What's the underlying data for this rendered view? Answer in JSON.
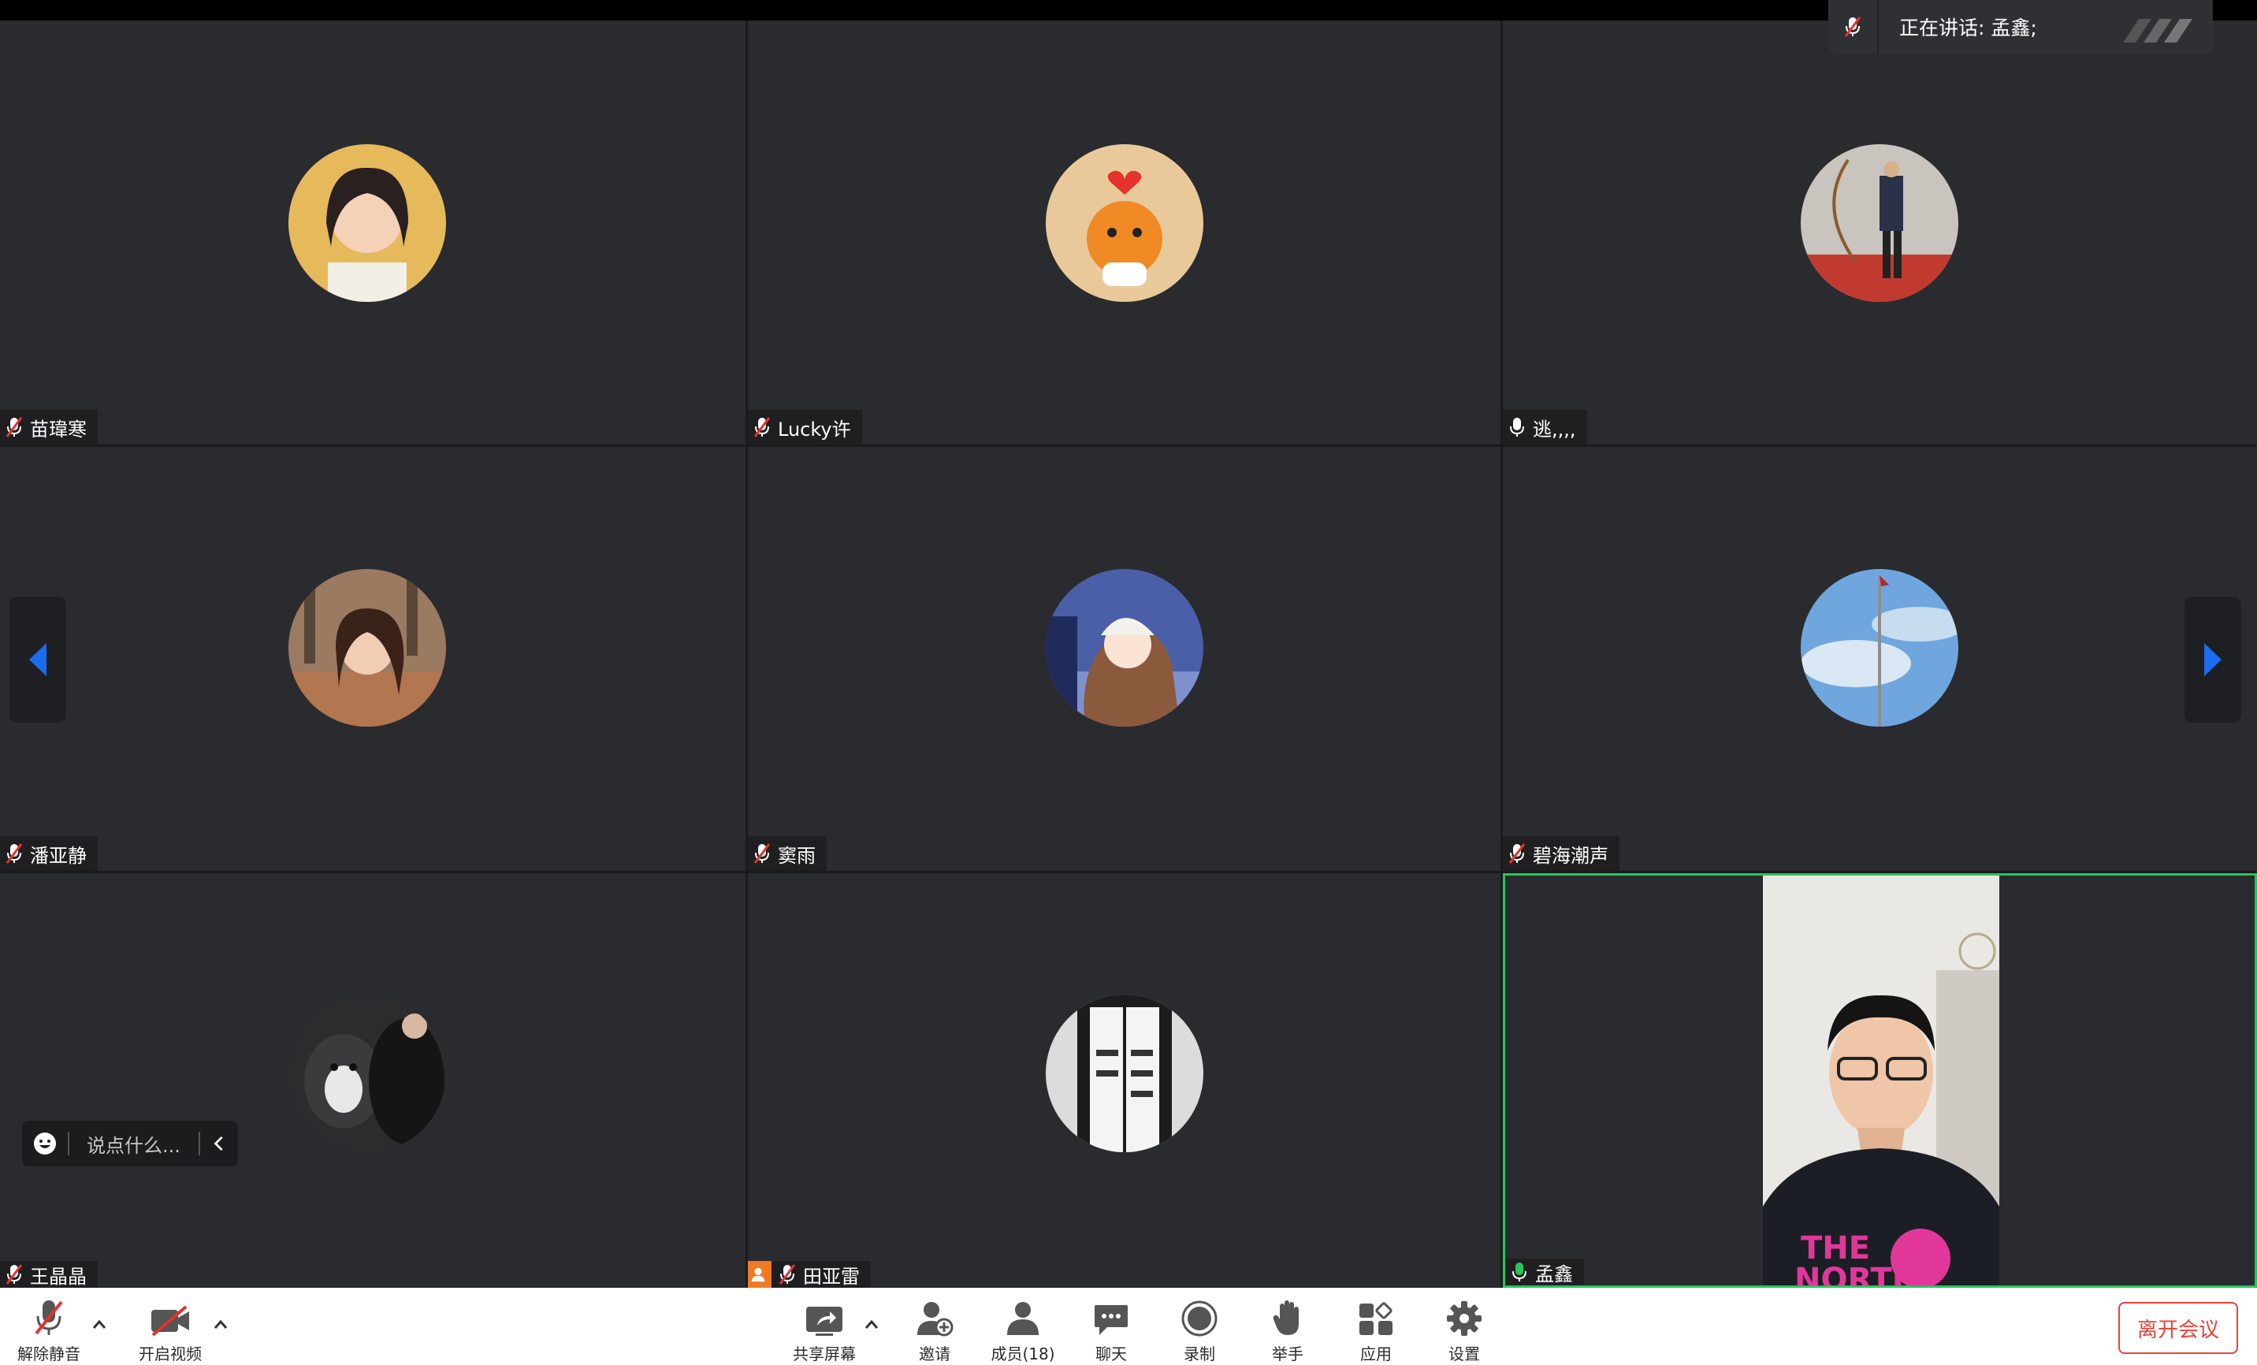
{
  "app": "meeting-video-grid",
  "active_speaker": {
    "label": "正在讲话: 孟鑫;"
  },
  "participants": [
    {
      "name": "苗瑋寒",
      "mic": "muted"
    },
    {
      "name": "Lucky许",
      "mic": "muted"
    },
    {
      "name": "逃,,,,",
      "mic": "on"
    },
    {
      "name": "潘亚静",
      "mic": "muted"
    },
    {
      "name": "窦雨",
      "mic": "muted"
    },
    {
      "name": "碧海潮声",
      "mic": "muted"
    },
    {
      "name": "王晶晶",
      "mic": "muted"
    },
    {
      "name": "田亚雷",
      "mic": "muted"
    },
    {
      "name": "孟鑫",
      "mic": "speaking"
    }
  ],
  "chat": {
    "placeholder": "说点什么..."
  },
  "toolbar": {
    "unmute": "解除静音",
    "start_video": "开启视频",
    "share_screen": "共享屏幕",
    "invite": "邀请",
    "members": "成员(18)",
    "chat": "聊天",
    "record": "录制",
    "raise_hand": "举手",
    "apps": "应用",
    "settings": "设置",
    "leave": "离开会议"
  },
  "colors": {
    "tile_bg": "#2a2b2e",
    "speaker_border": "#24c75a",
    "accent_blue": "#1a6cf0",
    "leave_red": "#e8443a",
    "muted_red": "#e5322d"
  }
}
